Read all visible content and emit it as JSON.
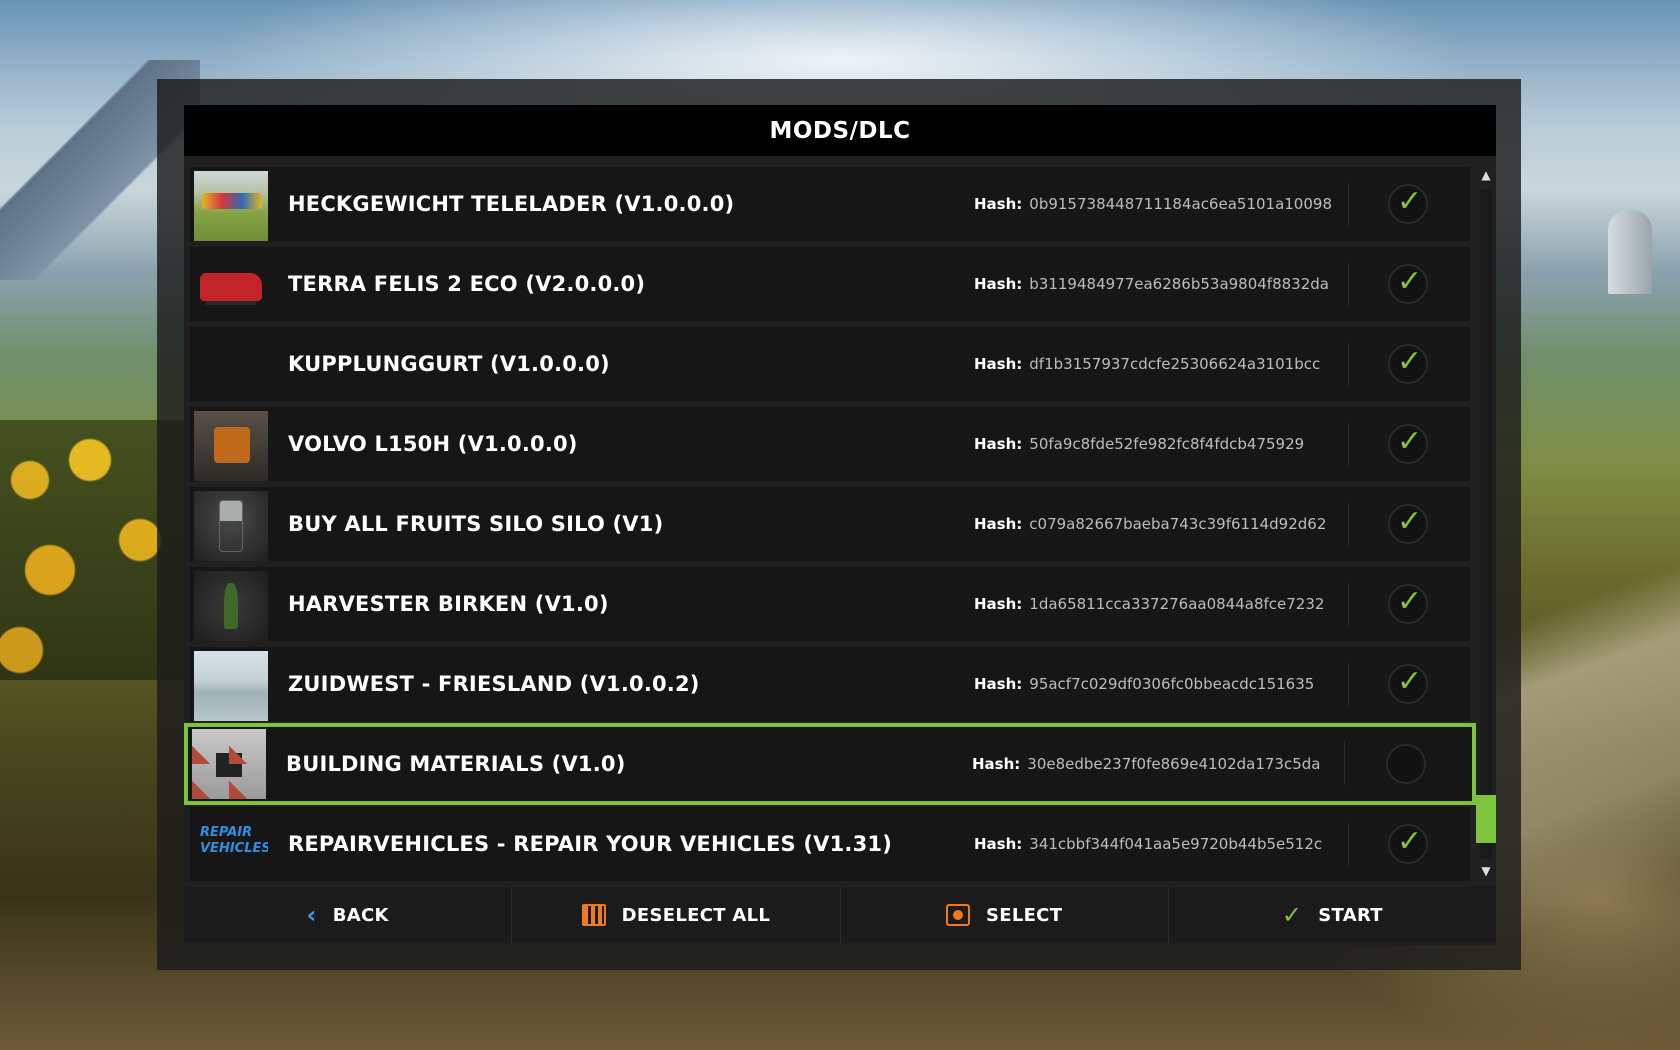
{
  "title": "MODS/DLC",
  "hash_label": "Hash:",
  "colors": {
    "accent": "#7cc43e",
    "orange": "#f07b1e",
    "blue": "#3a9ee0"
  },
  "mods": [
    {
      "name": "HECKGEWICHT TELELADER (V1.0.0.0)",
      "hash": "0b915738448711184ac6ea5101a10098",
      "checked": true,
      "thumb": "t-field"
    },
    {
      "name": "TERRA FELIS 2 ECO (V2.0.0.0)",
      "hash": "b3119484977ea6286b53a9804f8832da",
      "checked": true,
      "thumb": "t-harvester"
    },
    {
      "name": "KUPPLUNGGURT (V1.0.0.0)",
      "hash": "df1b3157937cdcfe25306624a3101bcc",
      "checked": true,
      "thumb": ""
    },
    {
      "name": "VOLVO L150H (V1.0.0.0)",
      "hash": "50fa9c8fde52fe982fc8f4fdcb475929",
      "checked": true,
      "thumb": "t-volvo"
    },
    {
      "name": "BUY ALL FRUITS SILO SILO (V1)",
      "hash": "c079a82667baeba743c39f6114d92d62",
      "checked": true,
      "thumb": "t-silo"
    },
    {
      "name": "HARVESTER BIRKEN (V1.0)",
      "hash": "1da65811cca337276aa0844a8fce7232",
      "checked": true,
      "thumb": "t-tree"
    },
    {
      "name": "ZUIDWEST - FRIESLAND (V1.0.0.2)",
      "hash": "95acf7c029df0306fc0bbeacdc151635",
      "checked": true,
      "thumb": "t-snow"
    },
    {
      "name": "BUILDING MATERIALS (V1.0)",
      "hash": "30e8edbe237f0fe869e4102da173c5da",
      "checked": false,
      "thumb": "t-materials",
      "selected": true
    },
    {
      "name": "REPAIRVEHICLES - REPAIR YOUR VEHICLES (V1.31)",
      "hash": "341cbbf344f041aa5e9720b44b5e512c",
      "checked": true,
      "thumb": "t-repair",
      "thumb_text": [
        "REPAIR",
        "VEHICLES"
      ]
    }
  ],
  "buttons": {
    "back": "BACK",
    "deselect_all": "DESELECT ALL",
    "select": "SELECT",
    "start": "START"
  },
  "icons": {
    "back": "chevron-left-icon",
    "deselect_all": "grid-deselect-icon",
    "select": "select-box-icon",
    "start": "checkmark-icon",
    "scroll_up": "triangle-up-icon",
    "scroll_down": "triangle-down-icon"
  }
}
